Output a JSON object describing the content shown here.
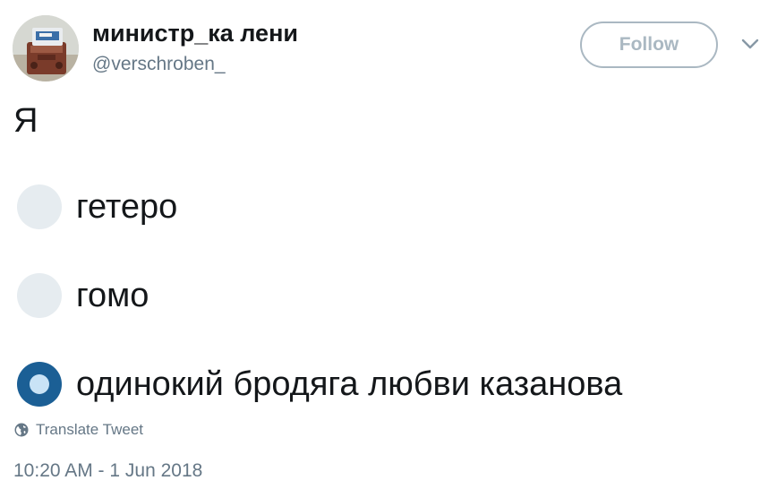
{
  "author": {
    "display_name": "министр_ка лени",
    "handle": "@verschroben_",
    "avatar_icon": "profile-photo-avatar"
  },
  "header": {
    "follow_label": "Follow",
    "menu_icon": "chevron-down-icon"
  },
  "tweet": {
    "text": "Я"
  },
  "poll": {
    "options": [
      {
        "label": "гетеро",
        "selected": false
      },
      {
        "label": "гомо",
        "selected": false
      },
      {
        "label": "одинокий бродяга любви казанова",
        "selected": true
      }
    ]
  },
  "footer": {
    "translate_label": "Translate Tweet",
    "translate_icon": "globe-icon",
    "timestamp": "10:20 AM - 1 Jun 2018"
  },
  "colors": {
    "text": "#14171a",
    "muted": "#657786",
    "follow_border": "#aab8c2",
    "radio_unselected": "#e6ecf0",
    "radio_selected": "#1b5f95",
    "radio_selected_dot": "#c9e3f6"
  }
}
